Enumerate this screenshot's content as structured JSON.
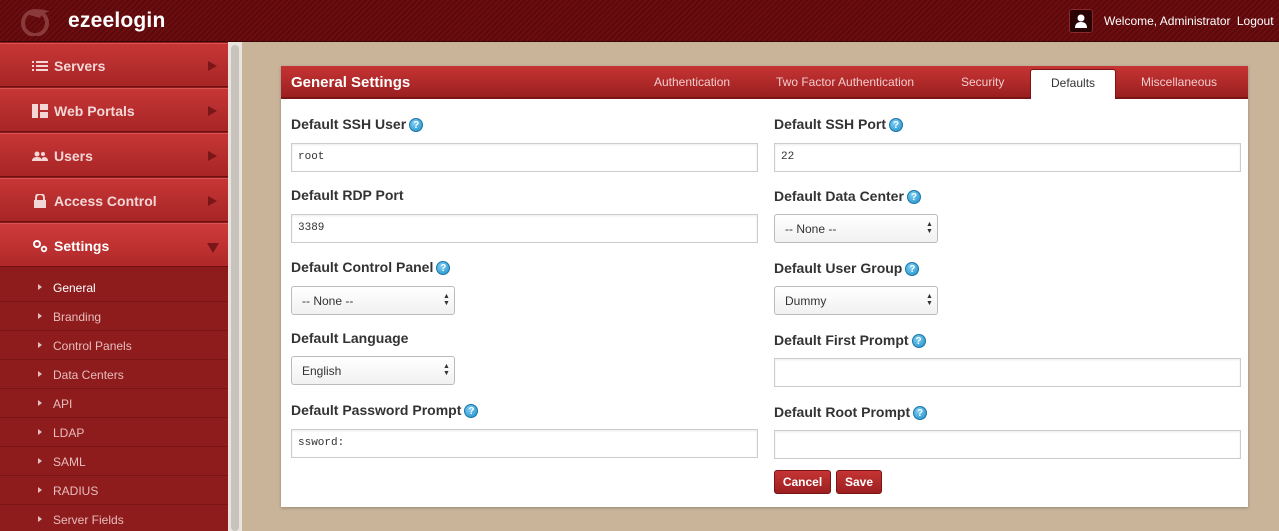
{
  "app": {
    "name": "ezeelogin",
    "welcome_text": "Welcome, Administrator",
    "logout_label": "Logout"
  },
  "sidebar": {
    "items": [
      {
        "label": "Servers",
        "icon": "list-icon"
      },
      {
        "label": "Web Portals",
        "icon": "grid-icon"
      },
      {
        "label": "Users",
        "icon": "users-icon"
      },
      {
        "label": "Access Control",
        "icon": "lock-icon"
      },
      {
        "label": "Settings",
        "icon": "gears-icon"
      }
    ],
    "submenu": [
      {
        "label": "General"
      },
      {
        "label": "Branding"
      },
      {
        "label": "Control Panels"
      },
      {
        "label": "Data Centers"
      },
      {
        "label": "API"
      },
      {
        "label": "LDAP"
      },
      {
        "label": "SAML"
      },
      {
        "label": "RADIUS"
      },
      {
        "label": "Server Fields"
      }
    ]
  },
  "panel": {
    "title": "General Settings",
    "tabs": [
      {
        "label": "Authentication"
      },
      {
        "label": "Two Factor Authentication"
      },
      {
        "label": "Security"
      },
      {
        "label": "Defaults"
      },
      {
        "label": "Miscellaneous"
      }
    ]
  },
  "form": {
    "ssh_user": {
      "label": "Default SSH User",
      "value": "root"
    },
    "ssh_port": {
      "label": "Default SSH Port",
      "value": "22"
    },
    "rdp_port": {
      "label": "Default RDP Port",
      "value": "3389"
    },
    "data_center": {
      "label": "Default Data Center",
      "value": "-- None --"
    },
    "control_panel": {
      "label": "Default Control Panel",
      "value": "-- None --"
    },
    "user_group": {
      "label": "Default User Group",
      "value": "Dummy"
    },
    "language": {
      "label": "Default Language",
      "value": "English"
    },
    "first_prompt": {
      "label": "Default First Prompt",
      "value": ""
    },
    "password_prompt": {
      "label": "Default Password Prompt",
      "value": "ssword:"
    },
    "root_prompt": {
      "label": "Default Root Prompt",
      "value": ""
    }
  },
  "buttons": {
    "cancel": "Cancel",
    "save": "Save"
  },
  "colors": {
    "brand": "#9b1f20",
    "help_icon": "#1e8cc6"
  }
}
